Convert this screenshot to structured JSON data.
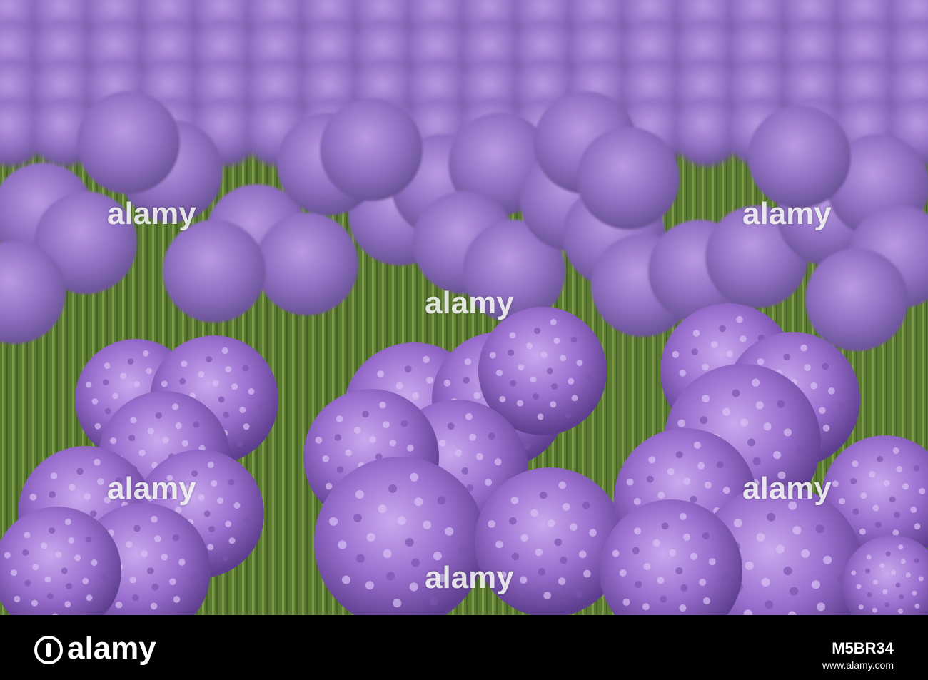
{
  "watermark": {
    "text": "alamy"
  },
  "footer": {
    "brand": "alamy",
    "image_id": "M5BR34",
    "url": "www.alamy.com"
  },
  "colors": {
    "flower": "#9b6fd0",
    "flower_dark": "#6c4a9e",
    "flower_light": "#c3a4ea",
    "foliage": "#5c7a32",
    "footer": "#000000"
  }
}
